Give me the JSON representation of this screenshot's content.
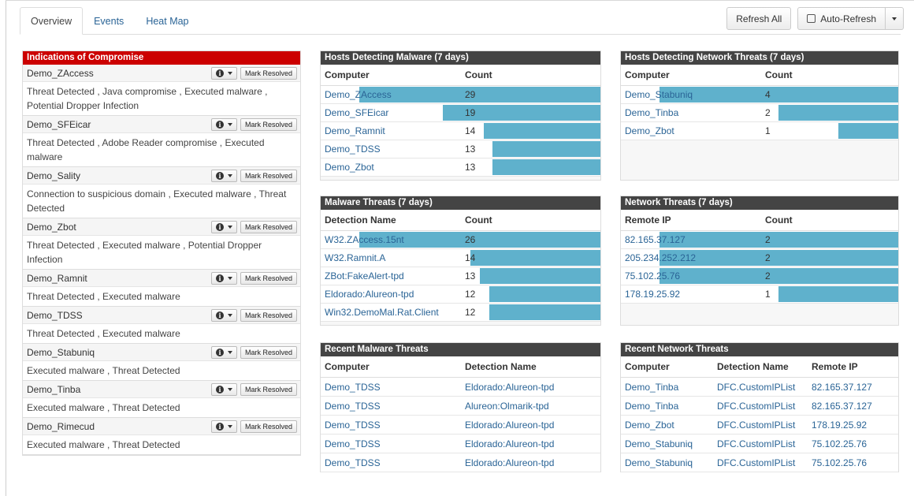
{
  "tabs": [
    {
      "label": "Overview",
      "active": true
    },
    {
      "label": "Events",
      "active": false
    },
    {
      "label": "Heat Map",
      "active": false
    }
  ],
  "toolbar": {
    "refresh_all": "Refresh All",
    "auto_refresh": "Auto-Refresh"
  },
  "colors": {
    "ioc_header": "#cc0000",
    "widget_header": "#444444",
    "bar": "#5fb1cc",
    "link": "#2a6496"
  },
  "ioc": {
    "title": "Indications of Compromise",
    "mark_label": "Mark Resolved",
    "items": [
      {
        "host": "Demo_ZAccess",
        "desc": "Threat Detected , Java compromise , Executed malware , Potential Dropper Infection"
      },
      {
        "host": "Demo_SFEicar",
        "desc": "Threat Detected , Adobe Reader compromise , Executed malware"
      },
      {
        "host": "Demo_Sality",
        "desc": "Connection to suspicious domain , Executed malware , Threat Detected"
      },
      {
        "host": "Demo_Zbot",
        "desc": "Threat Detected , Executed malware , Potential Dropper Infection"
      },
      {
        "host": "Demo_Ramnit",
        "desc": "Threat Detected , Executed malware"
      },
      {
        "host": "Demo_TDSS",
        "desc": "Threat Detected , Executed malware"
      },
      {
        "host": "Demo_Stabuniq",
        "desc": "Executed malware , Threat Detected"
      },
      {
        "host": "Demo_Tinba",
        "desc": "Executed malware , Threat Detected"
      },
      {
        "host": "Demo_Rimecud",
        "desc": "Executed malware , Threat Detected"
      }
    ]
  },
  "hosts_malware": {
    "title": "Hosts Detecting Malware (7 days)",
    "col1": "Computer",
    "col2": "Count",
    "max": 29,
    "rows": [
      {
        "name": "Demo_ZAccess",
        "count": 29
      },
      {
        "name": "Demo_SFEicar",
        "count": 19
      },
      {
        "name": "Demo_Ramnit",
        "count": 14
      },
      {
        "name": "Demo_TDSS",
        "count": 13
      },
      {
        "name": "Demo_Zbot",
        "count": 13
      }
    ]
  },
  "hosts_network": {
    "title": "Hosts Detecting Network Threats (7 days)",
    "col1": "Computer",
    "col2": "Count",
    "max": 4,
    "rows": [
      {
        "name": "Demo_Stabuniq",
        "count": 4
      },
      {
        "name": "Demo_Tinba",
        "count": 2
      },
      {
        "name": "Demo_Zbot",
        "count": 1
      }
    ]
  },
  "malware_threats": {
    "title": "Malware Threats (7 days)",
    "col1": "Detection Name",
    "col2": "Count",
    "max": 26,
    "rows": [
      {
        "name": "W32.ZAccess.15nt",
        "count": 26
      },
      {
        "name": "W32.Ramnit.A",
        "count": 14
      },
      {
        "name": "ZBot:FakeAlert-tpd",
        "count": 13
      },
      {
        "name": "Eldorado:Alureon-tpd",
        "count": 12
      },
      {
        "name": "Win32.DemoMal.Rat.Client",
        "count": 12
      }
    ]
  },
  "network_threats": {
    "title": "Network Threats (7 days)",
    "col1": "Remote IP",
    "col2": "Count",
    "max": 2,
    "rows": [
      {
        "name": "82.165.37.127",
        "count": 2
      },
      {
        "name": "205.234.252.212",
        "count": 2
      },
      {
        "name": "75.102.25.76",
        "count": 2
      },
      {
        "name": "178.19.25.92",
        "count": 1
      }
    ]
  },
  "recent_malware": {
    "title": "Recent Malware Threats",
    "cols": [
      "Computer",
      "Detection Name"
    ],
    "rows": [
      [
        "Demo_TDSS",
        "Eldorado:Alureon-tpd"
      ],
      [
        "Demo_TDSS",
        "Alureon:Olmarik-tpd"
      ],
      [
        "Demo_TDSS",
        "Eldorado:Alureon-tpd"
      ],
      [
        "Demo_TDSS",
        "Eldorado:Alureon-tpd"
      ],
      [
        "Demo_TDSS",
        "Eldorado:Alureon-tpd"
      ]
    ]
  },
  "recent_network": {
    "title": "Recent Network Threats",
    "cols": [
      "Computer",
      "Detection Name",
      "Remote IP"
    ],
    "rows": [
      [
        "Demo_Tinba",
        "DFC.CustomIPList",
        "82.165.37.127"
      ],
      [
        "Demo_Tinba",
        "DFC.CustomIPList",
        "82.165.37.127"
      ],
      [
        "Demo_Zbot",
        "DFC.CustomIPList",
        "178.19.25.92"
      ],
      [
        "Demo_Stabuniq",
        "DFC.CustomIPList",
        "75.102.25.76"
      ],
      [
        "Demo_Stabuniq",
        "DFC.CustomIPList",
        "75.102.25.76"
      ]
    ]
  }
}
